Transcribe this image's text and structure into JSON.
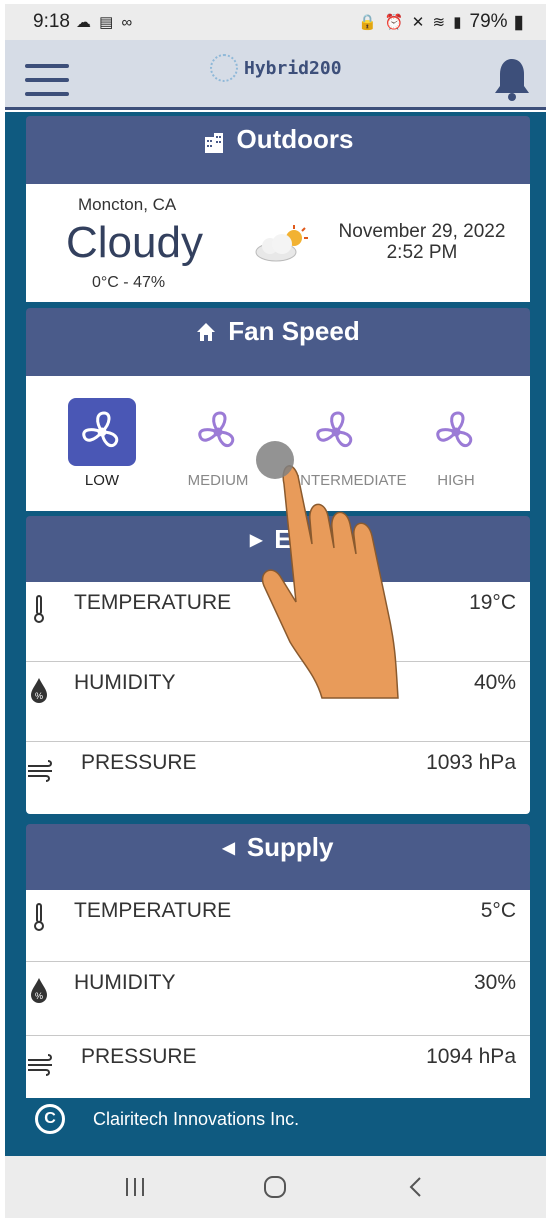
{
  "status_bar": {
    "time": "9:18",
    "left_icons": "☁ ▤ ∞",
    "battery": "79%"
  },
  "header": {
    "app_name": "Hybrid200"
  },
  "outdoors": {
    "title": "Outdoors",
    "location": "Moncton, CA",
    "condition": "Cloudy",
    "temp_humidity": "0°C - 47%",
    "date": "November 29, 2022",
    "time": "2:52 PM"
  },
  "fan_speed": {
    "title": "Fan Speed",
    "options": [
      "LOW",
      "MEDIUM",
      "INTERMEDIATE",
      "HIGH"
    ],
    "selected": "LOW"
  },
  "exhaust": {
    "title": "Ex",
    "rows": [
      {
        "label": "TEMPERATURE",
        "value": "19°C"
      },
      {
        "label": "HUMIDITY",
        "value": "40%"
      },
      {
        "label": "PRESSURE",
        "value": "1093 hPa"
      }
    ]
  },
  "supply": {
    "title": "Supply",
    "rows": [
      {
        "label": "TEMPERATURE",
        "value": "5°C"
      },
      {
        "label": "HUMIDITY",
        "value": "30%"
      },
      {
        "label": "PRESSURE",
        "value": "1094 hPa"
      }
    ]
  },
  "footer": {
    "copyright_symbol": "C",
    "company": "Clairitech Innovations Inc."
  },
  "colors": {
    "card_header": "#4a5b8a",
    "main_bg": "#0f5a80",
    "fan_active": "#4a57b5",
    "fan_icon": "#9b7bd6"
  }
}
